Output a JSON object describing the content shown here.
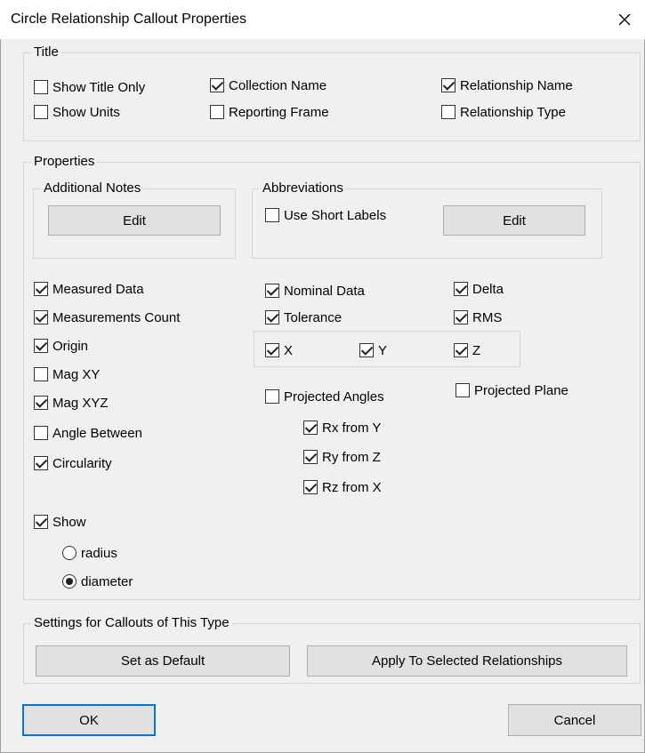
{
  "window": {
    "title": "Circle Relationship Callout Properties"
  },
  "title_group": {
    "label": "Title",
    "show_title_only": {
      "label": "Show Title Only",
      "checked": false
    },
    "show_units": {
      "label": "Show Units",
      "checked": false
    },
    "collection_name": {
      "label": "Collection Name",
      "checked": true
    },
    "reporting_frame": {
      "label": "Reporting Frame",
      "checked": false
    },
    "relationship_name": {
      "label": "Relationship Name",
      "checked": true
    },
    "relationship_type": {
      "label": "Relationship Type",
      "checked": false
    }
  },
  "properties_group": {
    "label": "Properties",
    "additional_notes": {
      "label": "Additional Notes",
      "edit_label": "Edit"
    },
    "abbreviations": {
      "label": "Abbreviations",
      "use_short_labels": "Use Short Labels",
      "use_short_checked": false,
      "edit_label": "Edit"
    },
    "measured_data": {
      "label": "Measured Data",
      "checked": true
    },
    "measurements_count": {
      "label": "Measurements Count",
      "checked": true
    },
    "origin": {
      "label": "Origin",
      "checked": true
    },
    "mag_xy": {
      "label": "Mag XY",
      "checked": false
    },
    "mag_xyz": {
      "label": "Mag XYZ",
      "checked": true
    },
    "angle_between": {
      "label": "Angle Between",
      "checked": false
    },
    "circularity": {
      "label": "Circularity",
      "checked": true
    },
    "nominal_data": {
      "label": "Nominal Data",
      "checked": true
    },
    "tolerance": {
      "label": "Tolerance",
      "checked": true
    },
    "delta": {
      "label": "Delta",
      "checked": true
    },
    "rms": {
      "label": "RMS",
      "checked": true
    },
    "x": {
      "label": "X",
      "checked": true
    },
    "y": {
      "label": "Y",
      "checked": true
    },
    "z": {
      "label": "Z",
      "checked": true
    },
    "projected_angles": {
      "label": "Projected Angles",
      "checked": false
    },
    "projected_plane": {
      "label": "Projected Plane",
      "checked": false
    },
    "rx_from_y": {
      "label": "Rx from Y",
      "checked": true
    },
    "ry_from_z": {
      "label": "Ry from Z",
      "checked": true
    },
    "rz_from_x": {
      "label": "Rz from X",
      "checked": true
    },
    "show": {
      "label": "Show",
      "checked": true
    },
    "radius": {
      "label": "radius",
      "selected": false
    },
    "diameter": {
      "label": "diameter",
      "selected": true
    }
  },
  "settings_group": {
    "label": "Settings for Callouts of This Type",
    "set_default": "Set as Default",
    "apply_selected": "Apply To Selected Relationships"
  },
  "footer": {
    "ok": "OK",
    "cancel": "Cancel"
  }
}
